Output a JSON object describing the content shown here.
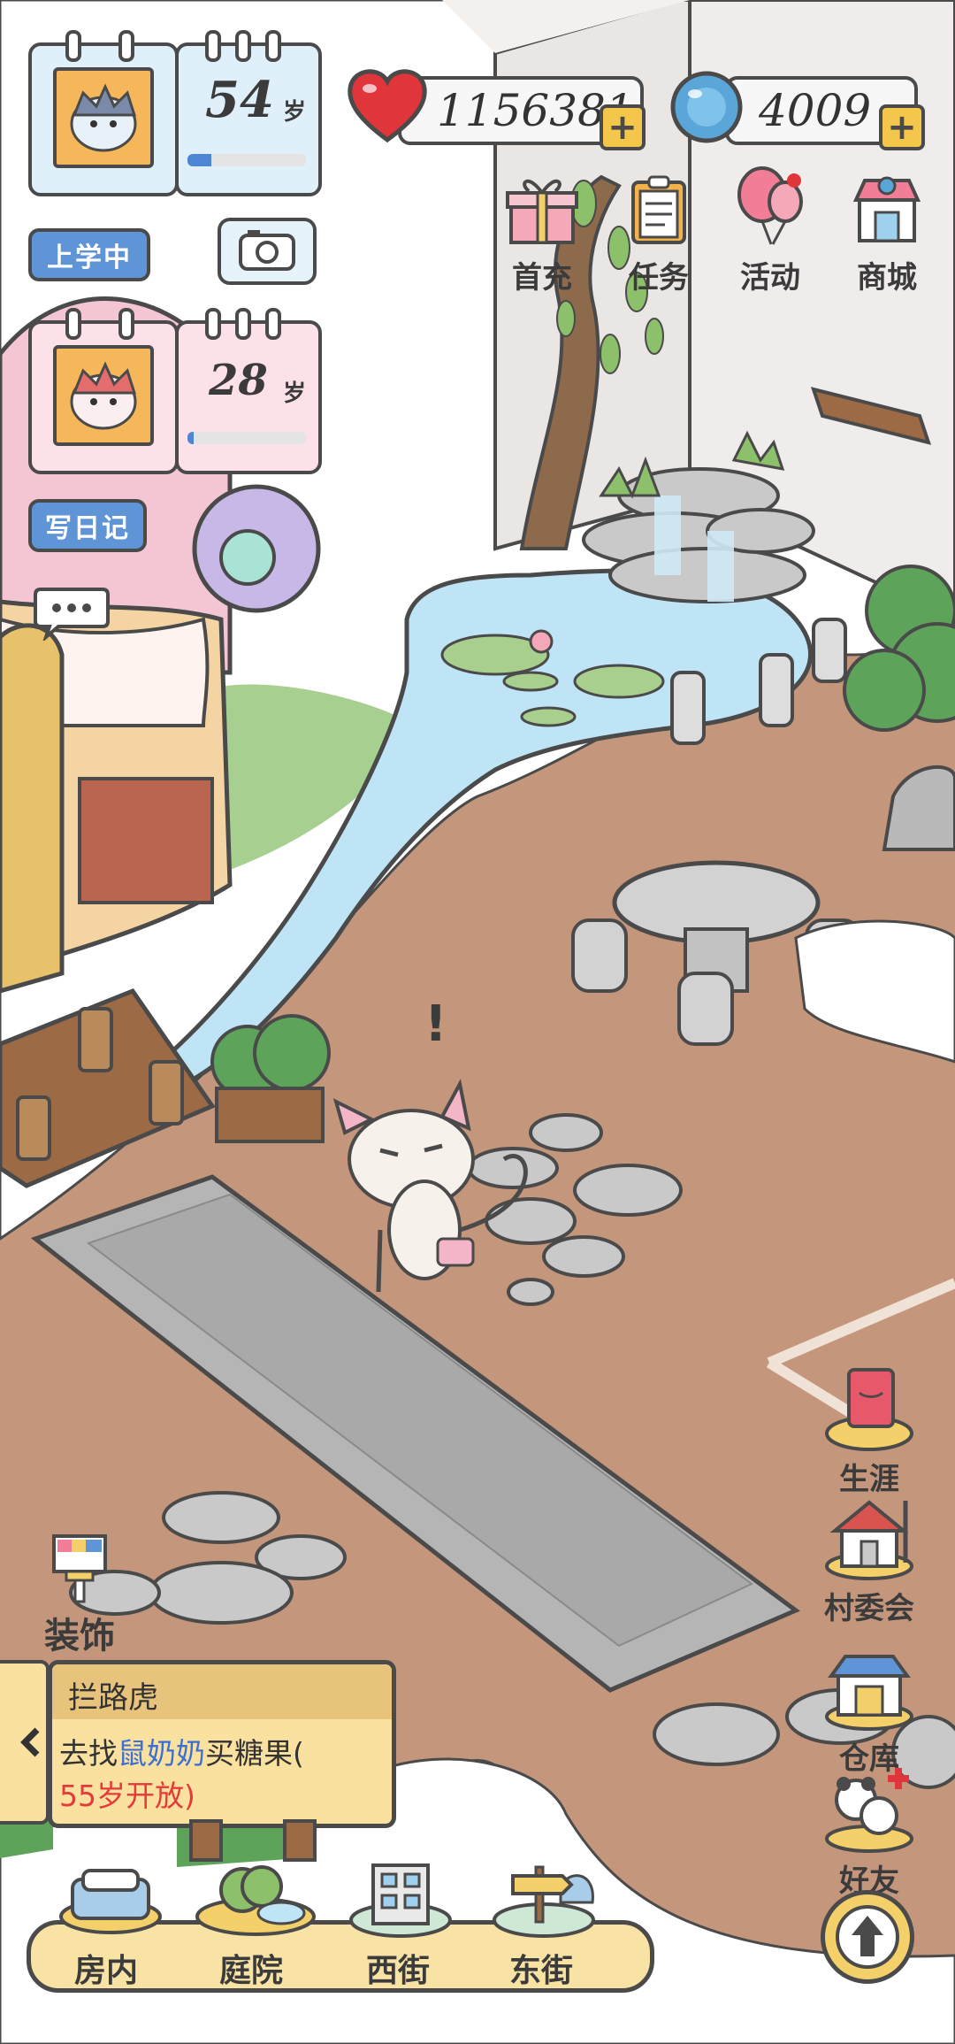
{
  "characters": [
    {
      "age": "54",
      "unit": "岁",
      "progress": 0.2,
      "status": "上学中",
      "avatar": "hedgehog-grandpa"
    },
    {
      "age": "28",
      "unit": "岁",
      "progress": 0.05,
      "status": "写日记",
      "avatar": "hedgehog-pink"
    }
  ],
  "resources": {
    "hearts": "1156381",
    "gems": "4009"
  },
  "top_menu": [
    {
      "label": "首充",
      "icon": "gift-icon"
    },
    {
      "label": "任务",
      "icon": "clipboard-icon"
    },
    {
      "label": "活动",
      "icon": "balloon-icon"
    },
    {
      "label": "商城",
      "icon": "shop-icon"
    }
  ],
  "side_menu": [
    {
      "label": "生涯",
      "icon": "book-icon"
    },
    {
      "label": "村委会",
      "icon": "village-house-icon"
    },
    {
      "label": "仓库",
      "icon": "warehouse-icon"
    },
    {
      "label": "好友",
      "icon": "panda-friends-icon"
    }
  ],
  "decorate": {
    "label": "装饰",
    "icon": "paint-palette-icon"
  },
  "quest": {
    "title": "拦路虎",
    "text_prefix": "去找",
    "text_highlight": "鼠奶奶",
    "text_suffix": "买糖果(",
    "text_unlock": "55岁开放)",
    "highlight_color": "#3b6fd6",
    "unlock_color": "#e53a3a"
  },
  "bottom_nav": [
    {
      "label": "房内",
      "icon": "bed-icon"
    },
    {
      "label": "庭院",
      "icon": "garden-icon"
    },
    {
      "label": "西街",
      "icon": "building-icon"
    },
    {
      "label": "东街",
      "icon": "signpost-icon"
    }
  ],
  "scene": {
    "exclaim": "!"
  },
  "colors": {
    "ground": "#c4967c",
    "snow": "#ffffff",
    "water": "#bfe4f5",
    "accent_blue": "#5f95d6",
    "heart": "#e0353a"
  }
}
